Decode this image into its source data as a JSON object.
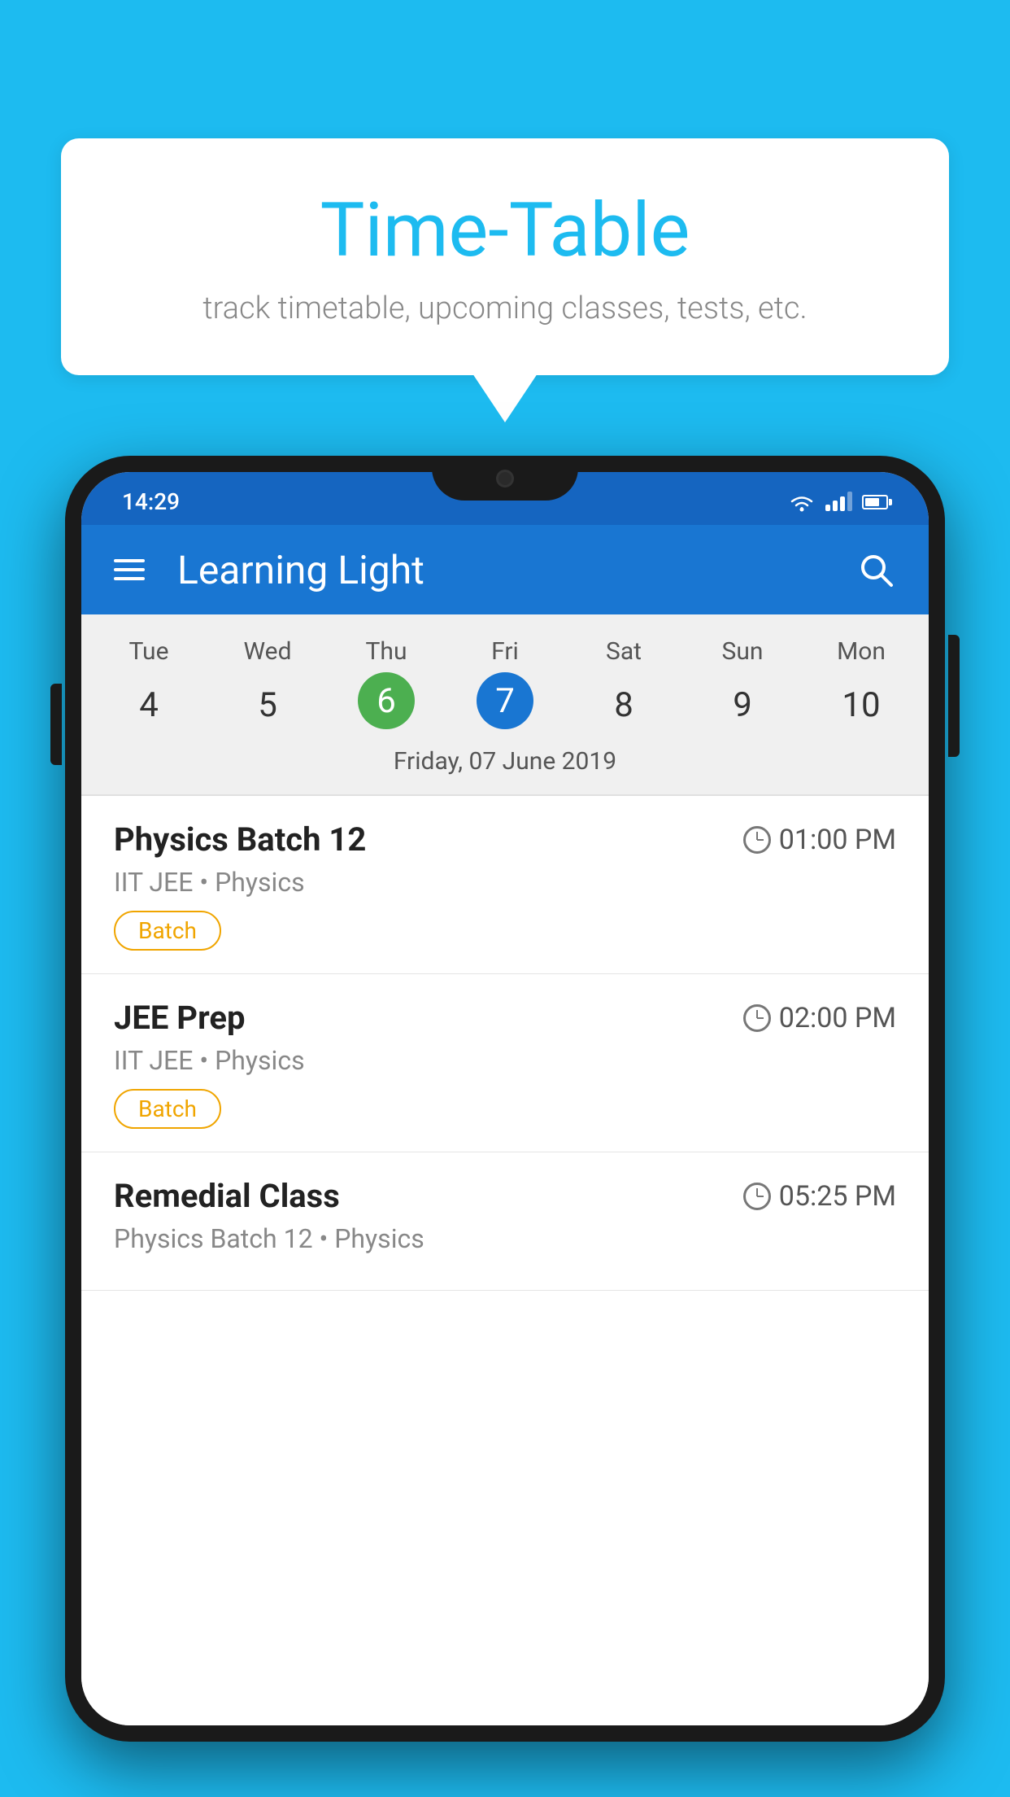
{
  "background": {
    "color": "#1DBBF0"
  },
  "speech_bubble": {
    "title": "Time-Table",
    "subtitle": "track timetable, upcoming classes, tests, etc."
  },
  "phone": {
    "status_bar": {
      "time": "14:29"
    },
    "app_bar": {
      "title": "Learning Light"
    },
    "calendar": {
      "days_of_week": [
        "Tue",
        "Wed",
        "Thu",
        "Fri",
        "Sat",
        "Sun",
        "Mon"
      ],
      "dates": [
        "4",
        "5",
        "6",
        "7",
        "8",
        "9",
        "10"
      ],
      "today_index": 2,
      "selected_index": 3,
      "selected_date_label": "Friday, 07 June 2019"
    },
    "schedule": [
      {
        "title": "Physics Batch 12",
        "time": "01:00 PM",
        "subtitle": "IIT JEE • Physics",
        "badge": "Batch"
      },
      {
        "title": "JEE Prep",
        "time": "02:00 PM",
        "subtitle": "IIT JEE • Physics",
        "badge": "Batch"
      },
      {
        "title": "Remedial Class",
        "time": "05:25 PM",
        "subtitle": "Physics Batch 12 • Physics",
        "badge": null
      }
    ]
  }
}
